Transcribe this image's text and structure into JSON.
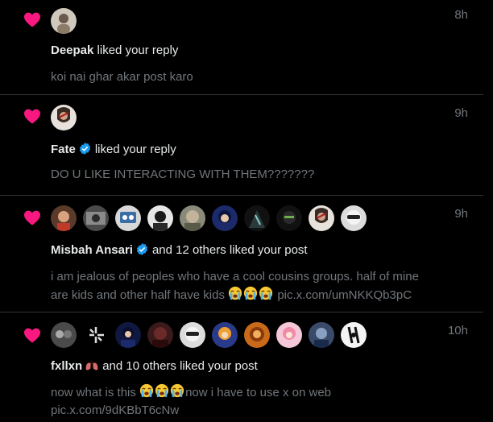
{
  "notifications": [
    {
      "time": "8h",
      "user": "Deepak",
      "verified": false,
      "action": "liked your reply",
      "preview": "koi nai ghar akar post karo"
    },
    {
      "time": "9h",
      "user": "Fate",
      "verified": true,
      "action": "liked your reply",
      "preview": "DO U LIKE INTERACTING WITH THEM???????"
    },
    {
      "time": "9h",
      "user": "Misbah Ansari",
      "verified": true,
      "action": "and 12 others liked your post",
      "preview_line1": "i am jealous of peoples who have a cool cousins groups. half of mine",
      "preview_line2_prefix": "are kids and other half have kids",
      "preview_link": "pic.x.com/umNKKQb3pC"
    },
    {
      "time": "10h",
      "user": "fxllxn",
      "verified": false,
      "action": "and 10 others liked your post",
      "preview_line1_prefix": "now what is this",
      "preview_line1_suffix": "now i have to use x on web",
      "preview_link": "pic.x.com/9dKBbT6cNw"
    }
  ],
  "colors": {
    "heart": "#f91880",
    "verified": "#1d9bf0",
    "muted": "#71767b"
  }
}
